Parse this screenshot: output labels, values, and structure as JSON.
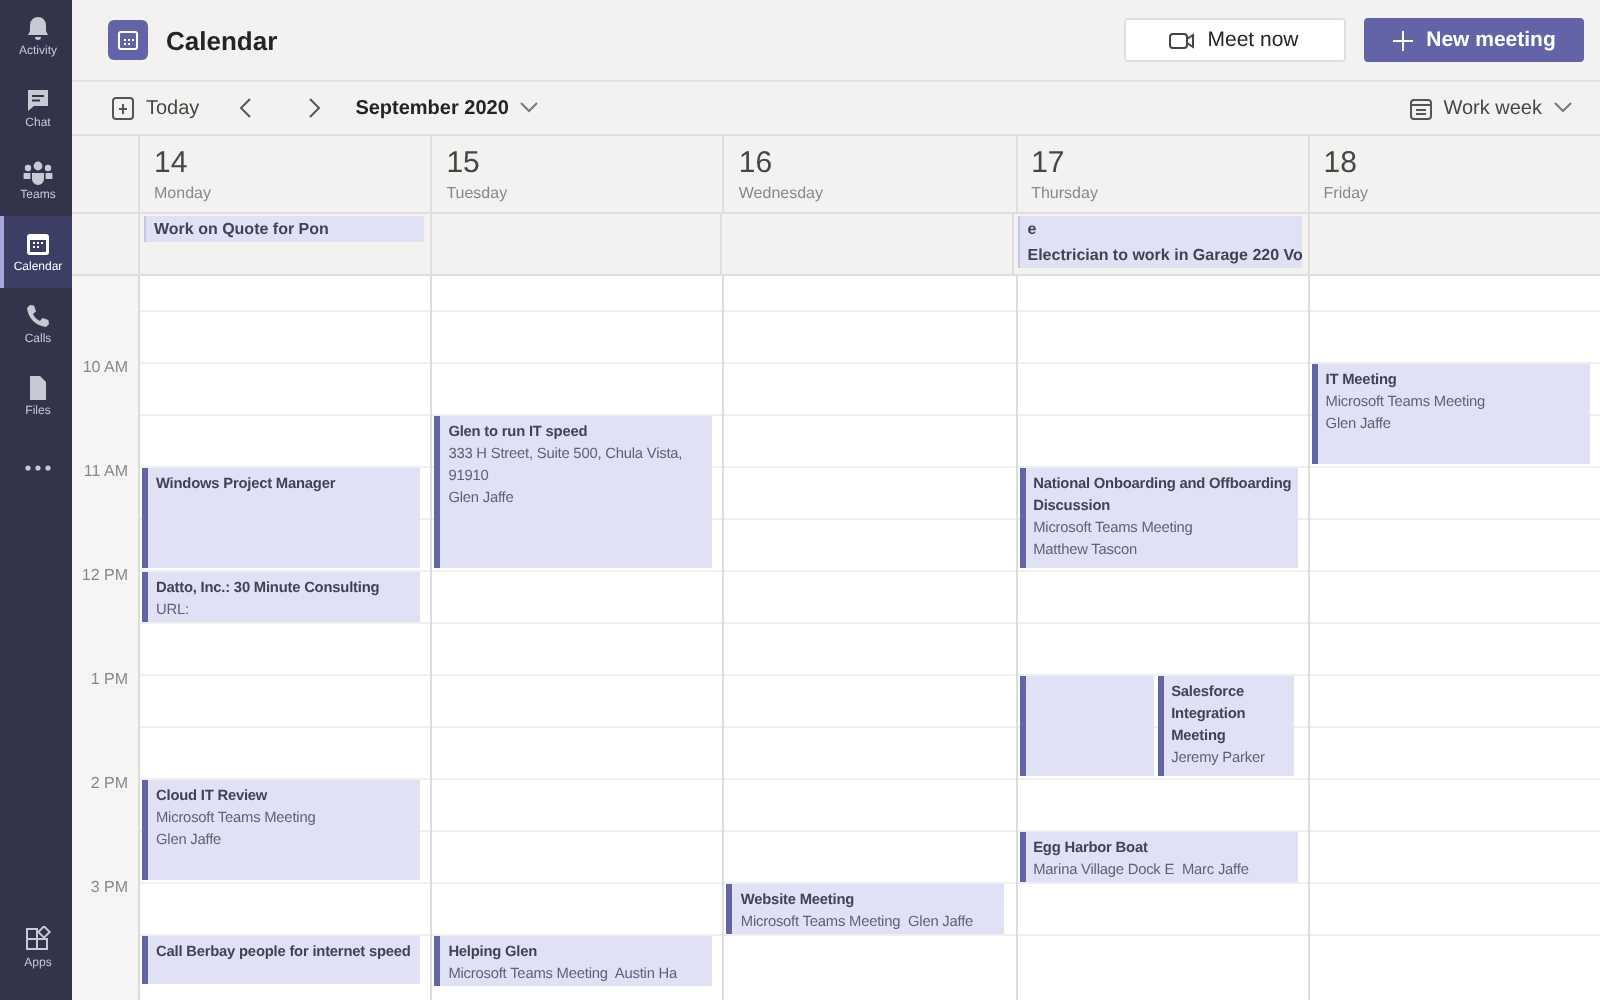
{
  "rail": {
    "items": [
      {
        "label": "Activity",
        "selected": false
      },
      {
        "label": "Chat",
        "selected": false
      },
      {
        "label": "Teams",
        "selected": false
      },
      {
        "label": "Calendar",
        "selected": true
      },
      {
        "label": "Calls",
        "selected": false
      },
      {
        "label": "Files",
        "selected": false
      },
      {
        "selected": false
      }
    ],
    "bottom": [
      {
        "label": "Apps",
        "selected": false
      }
    ]
  },
  "header": {
    "title": "Calendar",
    "buttons": [
      {
        "label": "Meet now",
        "kind": "secondary"
      },
      {
        "label": "New meeting",
        "kind": "primary"
      }
    ]
  },
  "toolbar": {
    "today": "Today",
    "month": "September 2020",
    "view": "Work week"
  },
  "days": [
    {
      "date": "14",
      "weekday": "Monday",
      "all_day": [
        "Work on Quote for Pon"
      ],
      "events": [
        {
          "kind": "meeting",
          "title": "Windows Project Manager"
        },
        {
          "kind": "meeting",
          "title": "Datto, Inc.: 30 Minute Consulting",
          "lines": [
            "URL:"
          ]
        },
        {
          "kind": "meeting",
          "title": "Cloud IT Review",
          "lines": [
            "Microsoft Teams Meeting",
            "Glen Jaffe"
          ]
        },
        {
          "kind": "meeting",
          "title": "Call Berbay people for internet speed"
        }
      ]
    },
    {
      "date": "15",
      "weekday": "Tuesday",
      "events": [
        {
          "kind": "meeting",
          "title": "Glen to run IT speed",
          "lines": [
            "333 H Street, Suite 500, Chula Vista, 91910",
            "Glen Jaffe"
          ]
        },
        {
          "kind": "meeting",
          "title": "Helping Glen",
          "lines": [
            "Microsoft Teams Meeting  Austin Ha"
          ]
        }
      ]
    },
    {
      "date": "16",
      "weekday": "Wednesday",
      "events": [
        {
          "kind": "meeting",
          "title": "Website Meeting",
          "lines": [
            "Microsoft Teams Meeting  Glen Jaffe"
          ]
        }
      ]
    },
    {
      "date": "17",
      "weekday": "Thursday",
      "all_day": [
        "e",
        "Electrician to work in Garage 220 Vo"
      ],
      "events": [
        {
          "kind": "meeting",
          "title": "National Onboarding and Offboarding Discussion",
          "lines": [
            "Microsoft Teams Meeting",
            "Matthew Tascon"
          ]
        },
        {
          "kind": "blank"
        },
        {
          "kind": "meeting",
          "title": "Salesforce Integration Meeting",
          "lines": [
            "Jeremy Parker"
          ]
        },
        {
          "kind": "meeting",
          "title": "Egg Harbor Boat",
          "lines": [
            "Marina Village Dock E  Marc Jaffe"
          ]
        }
      ]
    },
    {
      "date": "18",
      "weekday": "Friday",
      "events": [
        {
          "kind": "meeting",
          "title": "IT Meeting",
          "lines": [
            "Microsoft Teams Meeting",
            "Glen Jaffe"
          ]
        }
      ]
    }
  ],
  "hours": [
    "10 AM",
    "11 AM",
    "12 PM",
    "1 PM",
    "2 PM",
    "3 PM"
  ]
}
